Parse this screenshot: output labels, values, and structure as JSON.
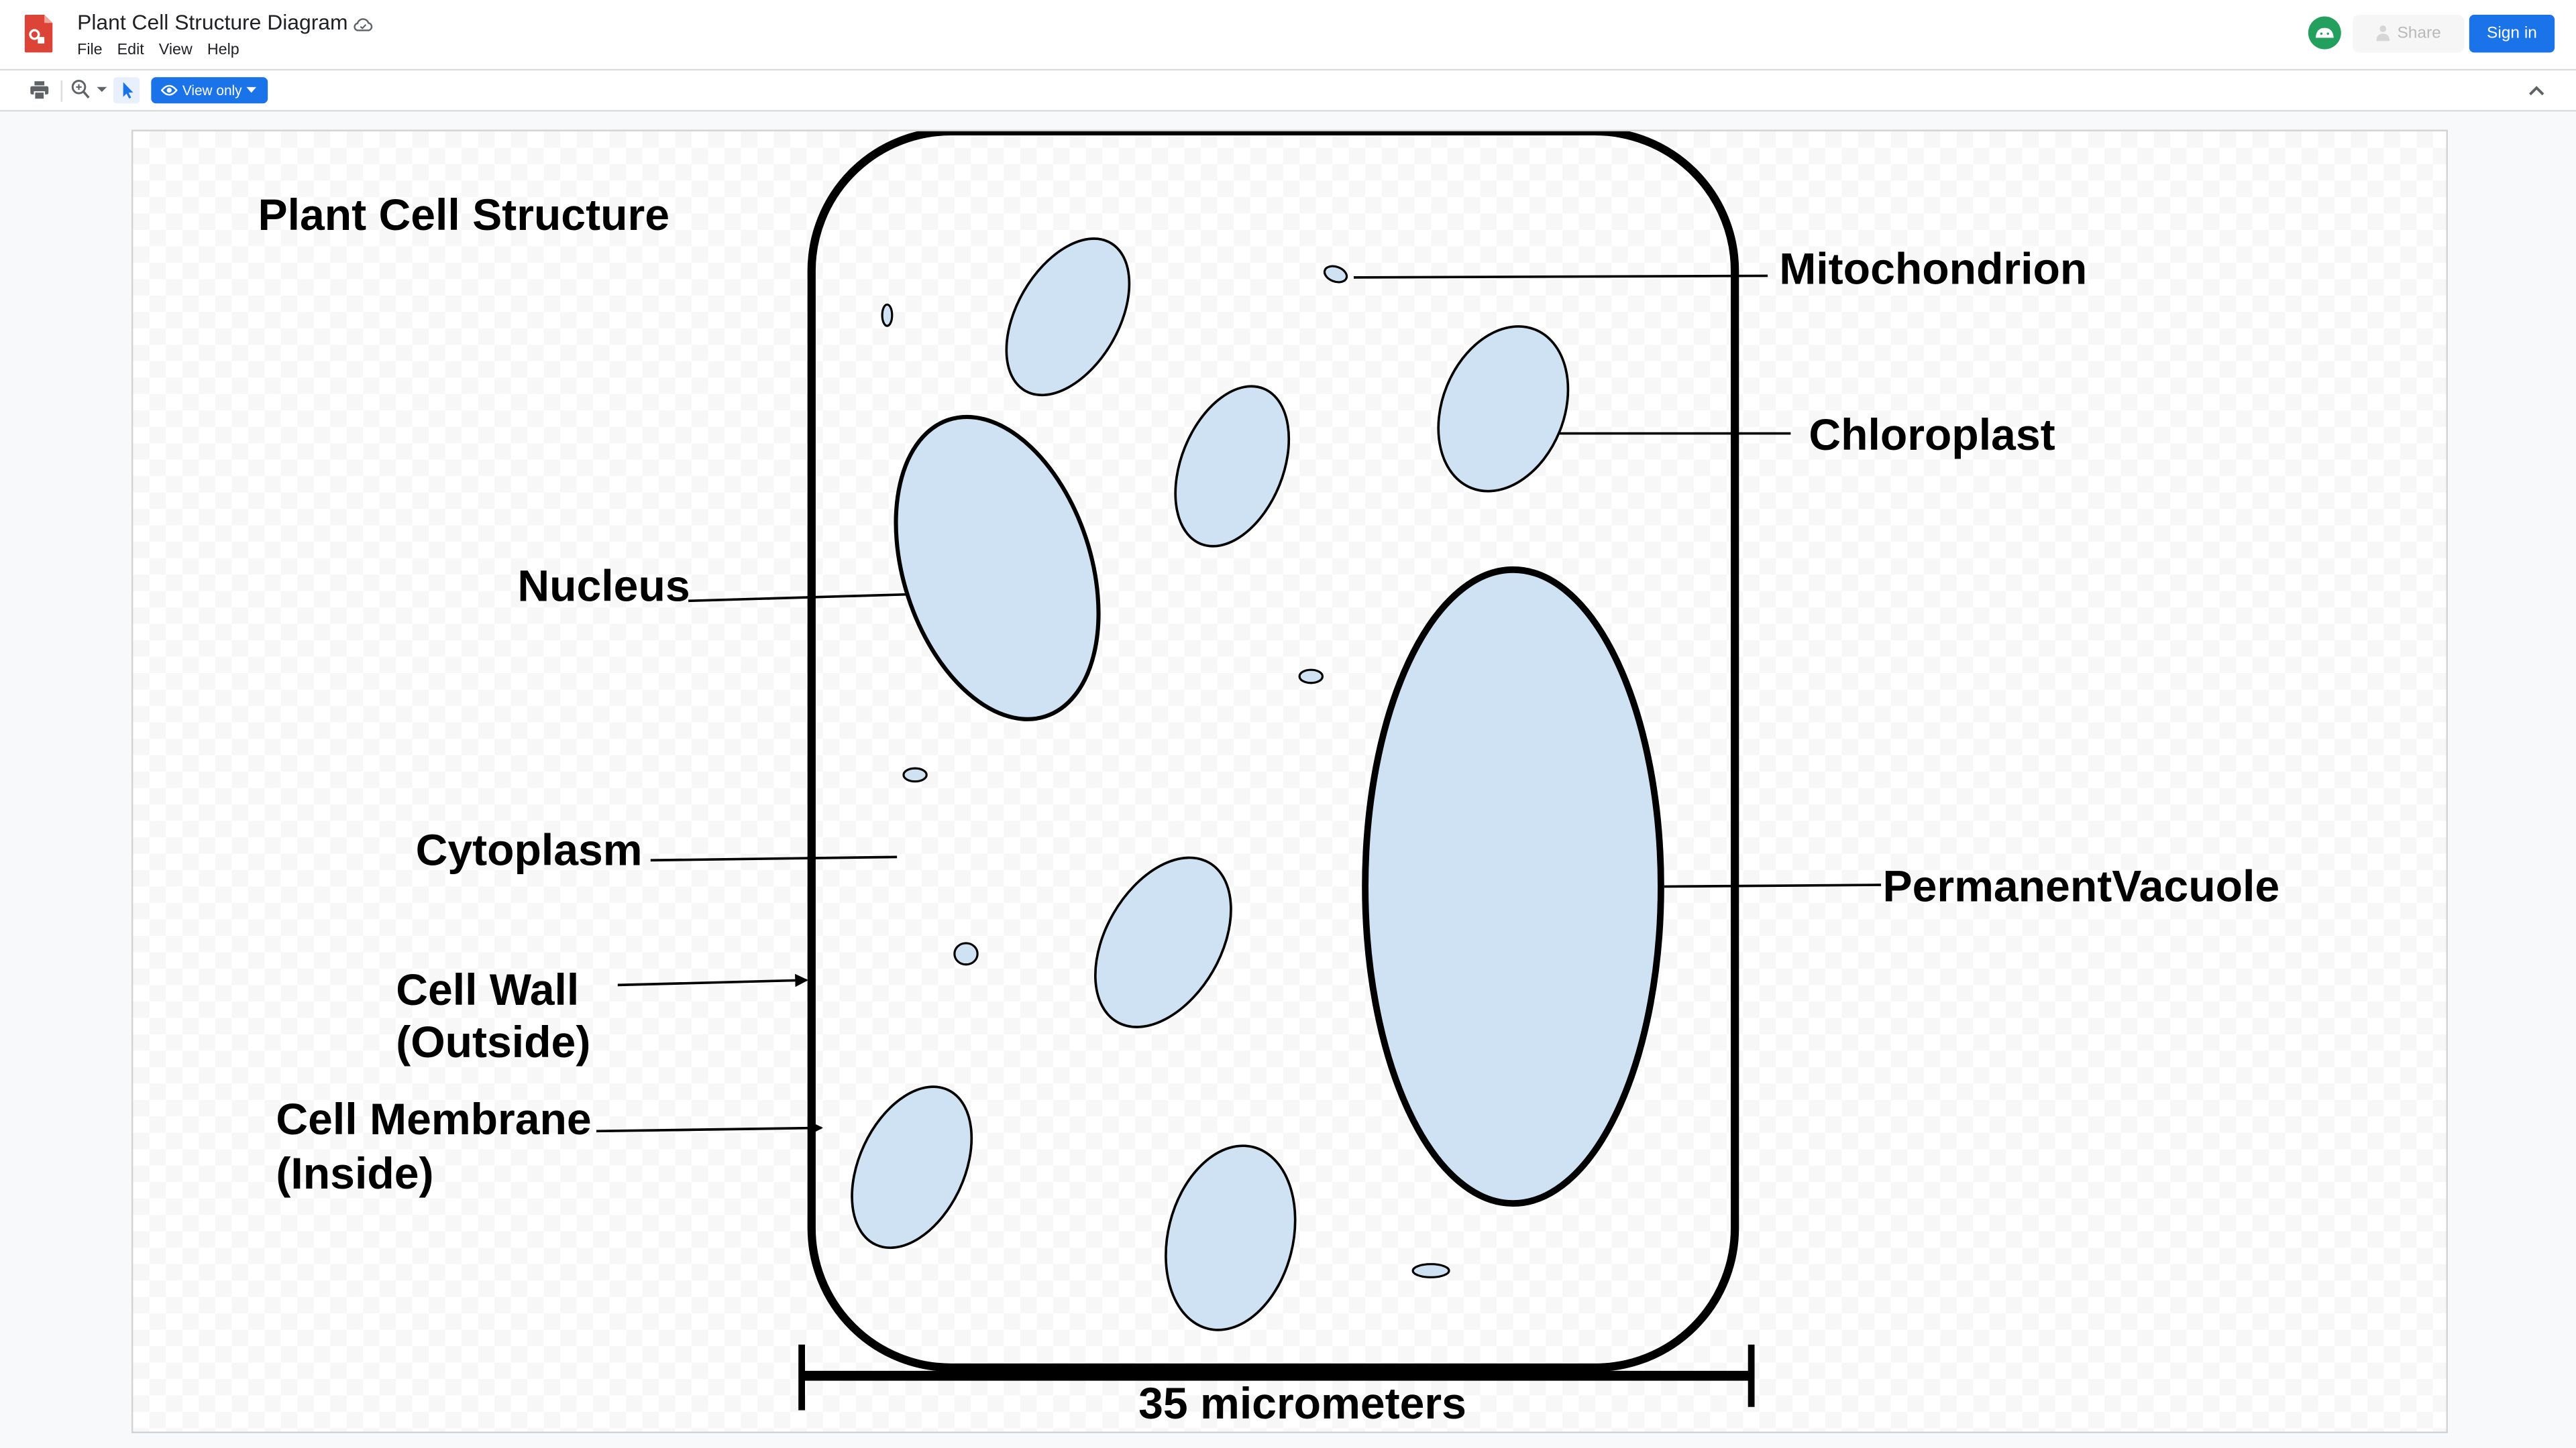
{
  "header": {
    "title": "Plant Cell Structure Diagram",
    "menu": [
      "File",
      "Edit",
      "View",
      "Help"
    ],
    "share_label": "Share",
    "signin_label": "Sign in"
  },
  "toolbar": {
    "view_mode_label": "View only"
  },
  "diagram": {
    "title": "Plant Cell Structure",
    "labels": {
      "mitochondrion": "Mitochondrion",
      "chloroplast": "Chloroplast",
      "nucleus": "Nucleus",
      "cytoplasm": "Cytoplasm",
      "cell_wall_1": "Cell Wall",
      "cell_wall_2": "(Outside)",
      "cell_membrane_1": "Cell Membrane",
      "cell_membrane_2": "(Inside)",
      "vacuole": "PermanentVacuole"
    },
    "scale_bar_label": "35 micrometers",
    "colors": {
      "organelle_fill": "#cfe2f3",
      "outline": "#000000",
      "accent": "#1a73e8"
    }
  }
}
